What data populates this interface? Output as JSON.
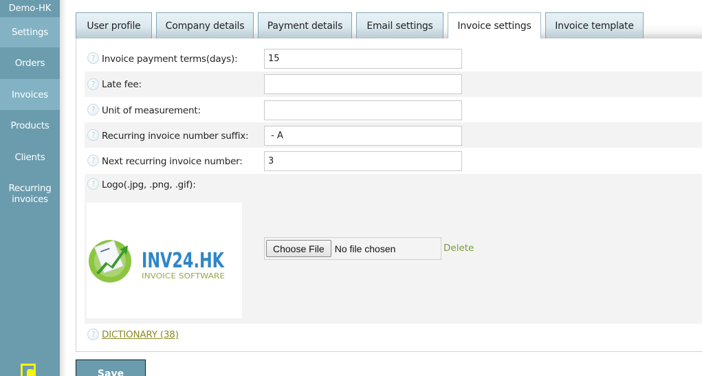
{
  "sidebar": {
    "brand": "Demo-HK",
    "items": [
      {
        "label": "Settings"
      },
      {
        "label": "Orders"
      },
      {
        "label": "Invoices"
      },
      {
        "label": "Products"
      },
      {
        "label": "Clients"
      },
      {
        "label": "Recurring invoices"
      }
    ],
    "exit_icon": "exit-icon"
  },
  "tabs": [
    {
      "label": "User profile",
      "active": false
    },
    {
      "label": "Company details",
      "active": false
    },
    {
      "label": "Payment details",
      "active": false
    },
    {
      "label": "Email settings",
      "active": false
    },
    {
      "label": "Invoice settings",
      "active": true
    },
    {
      "label": "Invoice template",
      "active": false
    }
  ],
  "form": {
    "help_icon": "?",
    "fields": [
      {
        "label": "Invoice payment terms(days):",
        "value": "15"
      },
      {
        "label": "Late fee:",
        "value": ""
      },
      {
        "label": "Unit of measurement:",
        "value": ""
      },
      {
        "label": "Recurring invoice number suffix:",
        "value": " - A"
      },
      {
        "label": "Next recurring invoice number:",
        "value": "3"
      }
    ],
    "logo": {
      "label": "Logo(.jpg, .png, .gif):",
      "brand_text": "INV24.HK",
      "brand_subtext": "INVOICE SOFTWARE",
      "choose_file_label": "Choose File",
      "no_file_text": "No file chosen",
      "delete_label": "Delete"
    },
    "dictionary_link": "DICTIONARY (38)"
  },
  "save_label": "Save",
  "colors": {
    "sidebar": "#6a9cae",
    "sidebar_highlight": "#82b2c4",
    "logo_blue": "#2f86c8",
    "logo_green": "#8cc63f",
    "delete_link": "#7a9a3a",
    "exit_icon": "#f5f50b"
  }
}
